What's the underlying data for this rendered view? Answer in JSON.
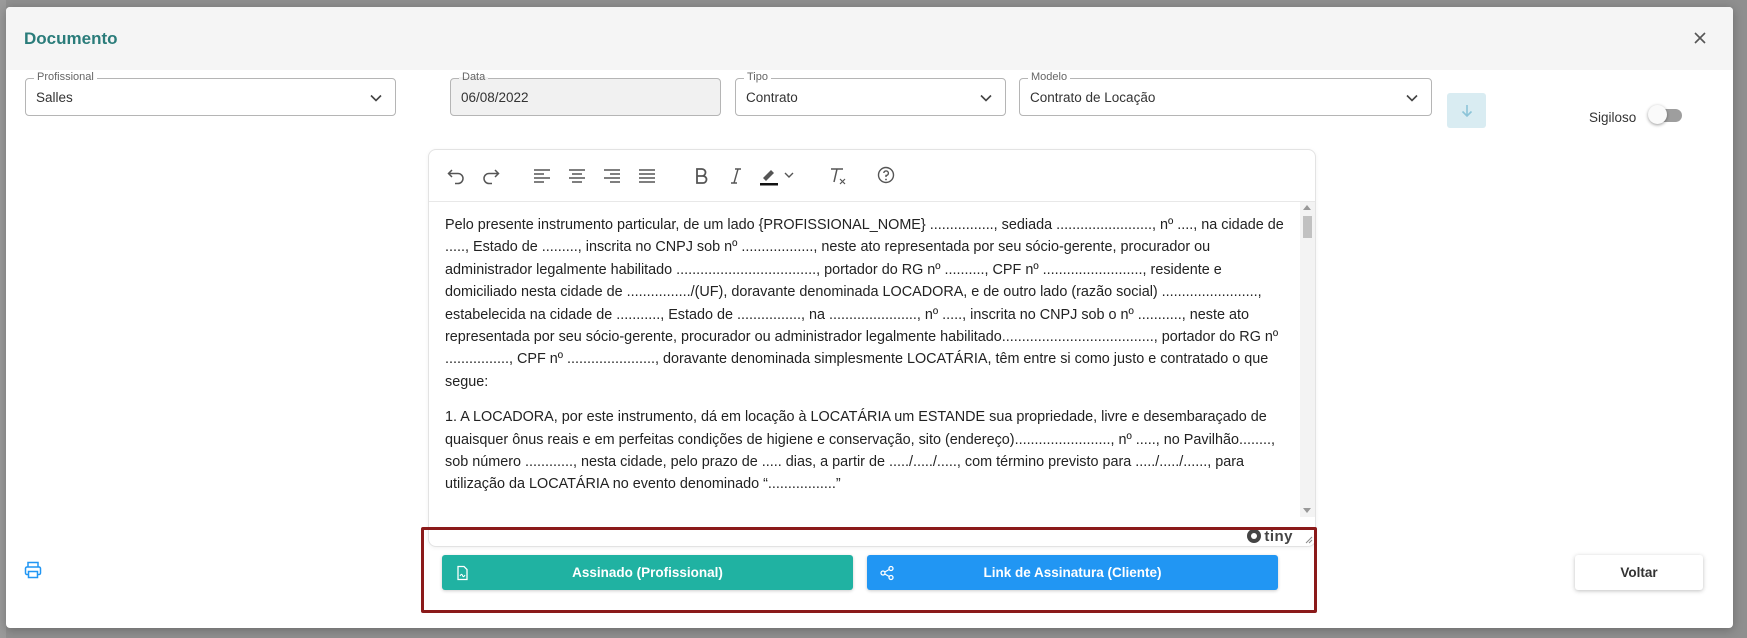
{
  "modal": {
    "title": "Documento"
  },
  "fields": {
    "profissional": {
      "label": "Profissional",
      "value": "Salles"
    },
    "data": {
      "label": "Data",
      "value": "06/08/2022"
    },
    "tipo": {
      "label": "Tipo",
      "value": "Contrato"
    },
    "modelo": {
      "label": "Modelo",
      "value": "Contrato de Locação"
    }
  },
  "sigiloso": {
    "label": "Sigiloso",
    "enabled": false
  },
  "toolbar": {
    "icons": [
      "undo-icon",
      "redo-icon",
      "align-left-icon",
      "align-center-icon",
      "align-right-icon",
      "align-justify-icon",
      "bold-icon",
      "italic-icon",
      "highlight-color-icon",
      "clear-format-icon",
      "help-icon"
    ]
  },
  "editor": {
    "paragraphs": [
      "Pelo presente instrumento particular, de um lado {PROFISSIONAL_NOME} ................, sediada ........................, nº ...., na cidade de ....., Estado de ........., inscrita no CNPJ sob  nº .................., neste ato representada por seu sócio-gerente, procurador ou administrador legalmente habilitado ..................................., portador do RG nº .........., CPF nº ........................., residente e domiciliado nesta cidade de ................/(UF), doravante denominada LOCADORA, e de outro lado (razão social) ........................, estabelecida na cidade de ..........., Estado de ................, na ......................, nº ....., inscrita no CNPJ sob o nº ..........., neste ato representada por seu sócio-gerente, procurador ou administrador legalmente habilitado......................................, portador do RG nº ................, CPF nº ......................, doravante denominada simplesmente LOCATÁRIA, têm entre si como justo e contratado o que segue:",
      "1. A  LOCADORA, por este instrumento, dá em locação à LOCATÁRIA um ESTANDE sua propriedade, livre e desembaraçado de quaisquer ônus reais e em perfeitas condições de higiene e conservação, sito (endereço)........................, nº ....., no Pavilhão........, sob número ............, nesta cidade, pelo prazo de ..... dias, a partir de ...../...../....., com término previsto para ...../...../......, para utilização da LOCATÁRIA no evento denominado “.................”"
    ],
    "brand": "tiny"
  },
  "actions": {
    "signed_label": "Assinado (Profissional)",
    "link_label": "Link de Assinatura (Cliente)",
    "back_label": "Voltar"
  },
  "colors": {
    "title": "#2a7c7a",
    "signed_button": "#20b2a2",
    "link_button": "#2196f3",
    "highlight_border": "#8b1a1a"
  }
}
